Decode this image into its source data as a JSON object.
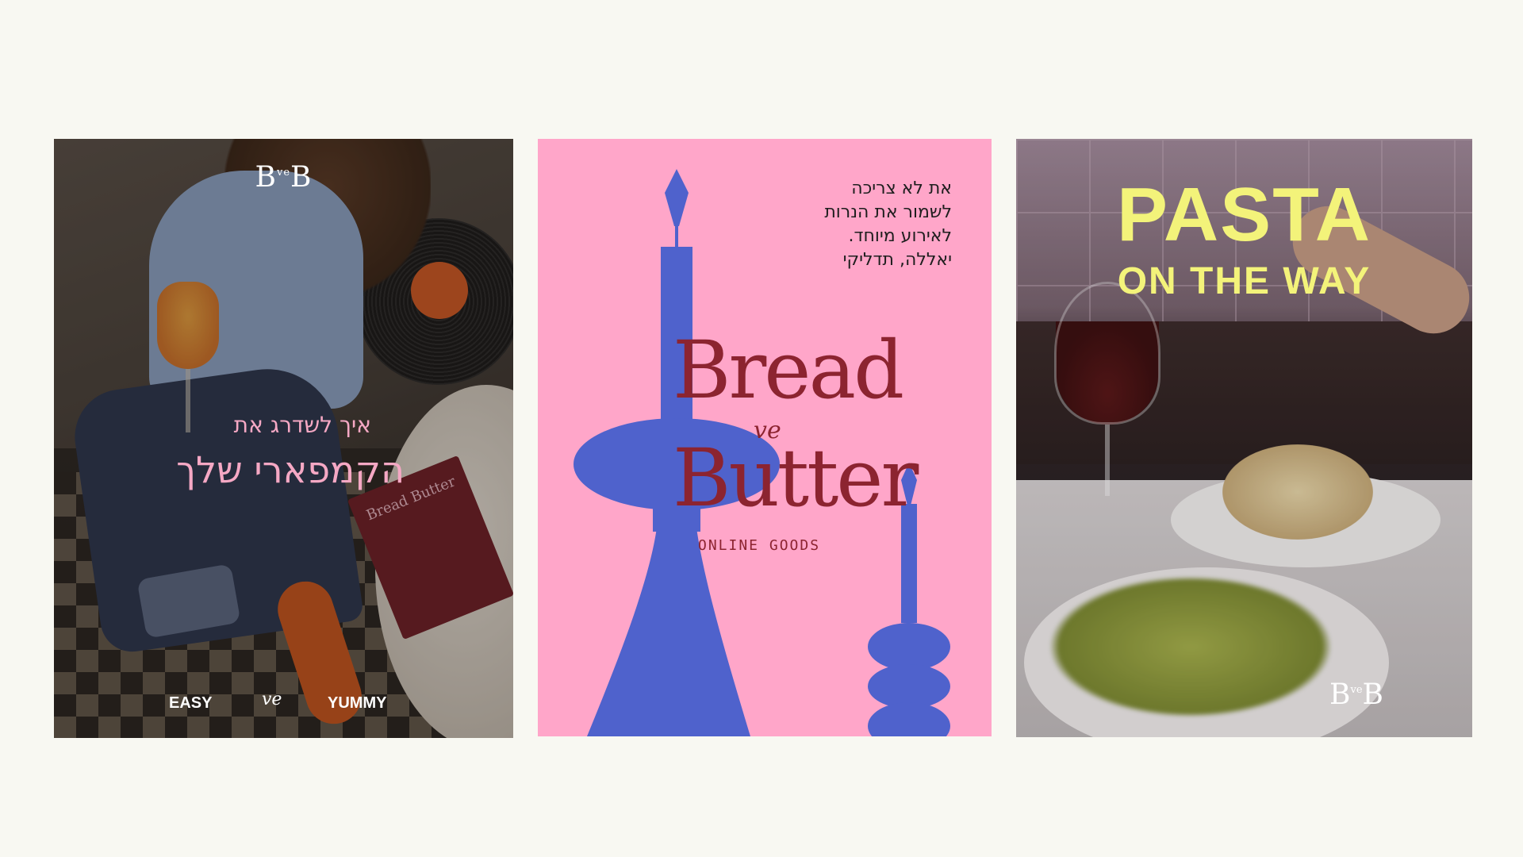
{
  "card1": {
    "logo_left": "B",
    "logo_sup": "ve",
    "logo_right": "B",
    "headline_line1": "איך לשדרג את",
    "headline_line2": "הקמפארי שלך",
    "menu_text": "Bread Butter",
    "footer_left": "EASY",
    "footer_mid": "ve",
    "footer_right": "YUMMY",
    "colors": {
      "headline": "#f5a8c4",
      "footer": "#ffffff"
    }
  },
  "card2": {
    "text_lines": [
      "את לא צריכה",
      "לשמור את הנרות",
      "לאירוע מיוחד.",
      "יאללה, תדליקי"
    ],
    "brand_word1": "Bread",
    "brand_ve": "ve",
    "brand_word2": "Butter",
    "tagline": "ONLINE GOODS",
    "colors": {
      "background": "#ffa6c9",
      "candles": "#4f62cc",
      "brand": "#8c2430"
    }
  },
  "card3": {
    "headline": "PASTA",
    "subheadline": "ON THE WAY",
    "logo_left": "B",
    "logo_sup": "ve",
    "logo_right": "B",
    "colors": {
      "headline": "#f3f37a",
      "logo": "#ffffff"
    }
  }
}
